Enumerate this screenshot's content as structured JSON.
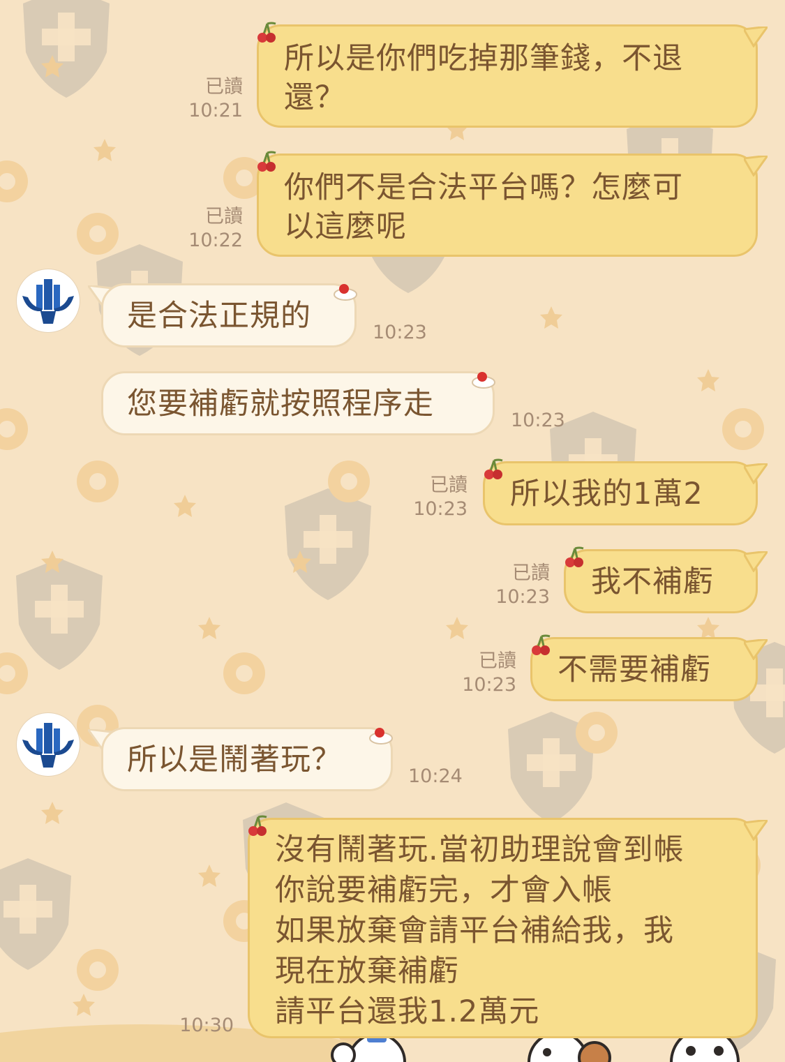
{
  "colors": {
    "background": "#f7e3c4",
    "my_bubble": "#f8de8d",
    "my_bubble_border": "#e9c46b",
    "their_bubble": "#fdf6e8",
    "text": "#7a5530",
    "meta_text": "#a58b74",
    "avatar_brand": "#2158a8"
  },
  "messages": [
    {
      "side": "mine",
      "text": "所以是你們吃掉那筆錢，不退\n還？",
      "read": "已讀",
      "time": "10:21"
    },
    {
      "side": "mine",
      "text": "你們不是合法平台嗎？怎麼可\n以這麼呢",
      "read": "已讀",
      "time": "10:22"
    },
    {
      "side": "theirs",
      "text": "是合法正規的",
      "time": "10:23",
      "avatar_icon": "bull-tower-logo"
    },
    {
      "side": "theirs",
      "text": "您要補虧就按照程序走",
      "time": "10:23"
    },
    {
      "side": "mine",
      "text": "所以我的1萬2",
      "read": "已讀",
      "time": "10:23"
    },
    {
      "side": "mine",
      "text": "我不補虧",
      "read": "已讀",
      "time": "10:23"
    },
    {
      "side": "mine",
      "text": "不需要補虧",
      "read": "已讀",
      "time": "10:23"
    },
    {
      "side": "theirs",
      "text": "所以是鬧著玩？",
      "time": "10:24",
      "avatar_icon": "bull-tower-logo"
    },
    {
      "side": "mine",
      "text": "沒有鬧著玩.當初助理說會到帳\n你說要補虧完，才會入帳\n如果放棄會請平台補給我，我\n現在放棄補虧\n請平台還我1.2萬元",
      "time": "10:30"
    }
  ]
}
